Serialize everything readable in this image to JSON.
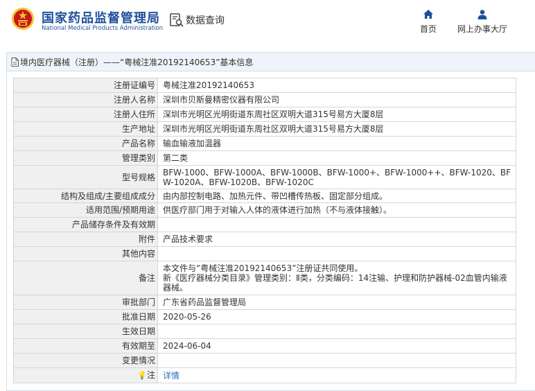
{
  "header": {
    "logo_cn": "国家药品监督管理局",
    "logo_en": "National Medical Products Administration",
    "query_label": "数据查询",
    "nav": [
      {
        "label": "首页",
        "icon": "home-icon"
      },
      {
        "label": "网上办事大厅",
        "icon": "user-icon"
      }
    ]
  },
  "panel": {
    "title": "境内医疗器械（注册）——“粤械注准20192140653”基本信息"
  },
  "rows": [
    {
      "label": "注册证编号",
      "value": "粤械注准20192140653"
    },
    {
      "label": "注册人名称",
      "value": "深圳市贝斯曼精密仪器有限公司"
    },
    {
      "label": "注册人住所",
      "value": "深圳市光明区光明街道东周社区双明大道315号易方大厦8层"
    },
    {
      "label": "生产地址",
      "value": "深圳市光明区光明街道东周社区双明大道315号易方大厦8层"
    },
    {
      "label": "产品名称",
      "value": "输血输液加温器"
    },
    {
      "label": "管理类别",
      "value": "第二类"
    },
    {
      "label": "型号规格",
      "value": "BFW-1000、BFW-1000A、BFW-1000B、BFW-1000+、BFW-1000++、BFW-1020、BFW-1020A、BFW-1020B、BFW-1020C"
    },
    {
      "label": "结构及组成/主要组成成分",
      "value": "由内部控制电路、加热元件、带凹槽传热板、固定部分组成。"
    },
    {
      "label": "适用范围/预期用途",
      "value": "供医疗部门用于对输入人体的液体进行加热（不与液体接触）。"
    },
    {
      "label": "产品储存条件及有效期",
      "value": ""
    },
    {
      "label": "附件",
      "value": "产品技术要求"
    },
    {
      "label": "其他内容",
      "value": ""
    },
    {
      "label": "备注",
      "value": "本文件与“粤械注准20192140653”注册证共同使用。\n新《医疗器械分类目录》管理类别：Ⅱ类，分类编码：14注输、护理和防护器械-02血管内输液器械。"
    },
    {
      "label": "审批部门",
      "value": "广东省药品监督管理局"
    },
    {
      "label": "批准日期",
      "value": "2020-05-26"
    },
    {
      "label": "生效日期",
      "value": ""
    },
    {
      "label": "有效期至",
      "value": "2024-06-04"
    },
    {
      "label": "变更情况",
      "value": ""
    }
  ],
  "note_row": {
    "label": "注",
    "icon": "lightbulb-icon",
    "link": "详情"
  },
  "colors": {
    "brand": "#1f4f9c",
    "label_bg": "#f0f0f0",
    "title_bg": "#eef4f9",
    "link": "#2a6ebb",
    "emblem_red": "#c8161d",
    "emblem_gold": "#f2c230"
  }
}
